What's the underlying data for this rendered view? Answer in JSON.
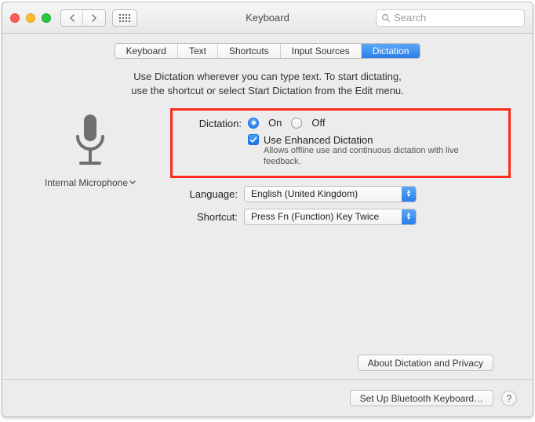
{
  "window": {
    "title": "Keyboard"
  },
  "search": {
    "placeholder": "Search"
  },
  "tabs": [
    {
      "label": "Keyboard",
      "active": false
    },
    {
      "label": "Text",
      "active": false
    },
    {
      "label": "Shortcuts",
      "active": false
    },
    {
      "label": "Input Sources",
      "active": false
    },
    {
      "label": "Dictation",
      "active": true
    }
  ],
  "intro": {
    "line1": "Use Dictation wherever you can type text. To start dictating,",
    "line2": "use the shortcut or select Start Dictation from the Edit menu."
  },
  "mic": {
    "label": "Internal Microphone"
  },
  "dictation": {
    "label": "Dictation:",
    "on": "On",
    "off": "Off",
    "value": "on",
    "enhanced": {
      "checked": true,
      "title": "Use Enhanced Dictation",
      "sub": "Allows offline use and continuous dictation with live feedback."
    }
  },
  "language": {
    "label": "Language:",
    "value": "English (United Kingdom)"
  },
  "shortcut": {
    "label": "Shortcut:",
    "value": "Press Fn (Function) Key Twice"
  },
  "buttons": {
    "about": "About Dictation and Privacy",
    "bluetooth": "Set Up Bluetooth Keyboard…",
    "help": "?"
  }
}
